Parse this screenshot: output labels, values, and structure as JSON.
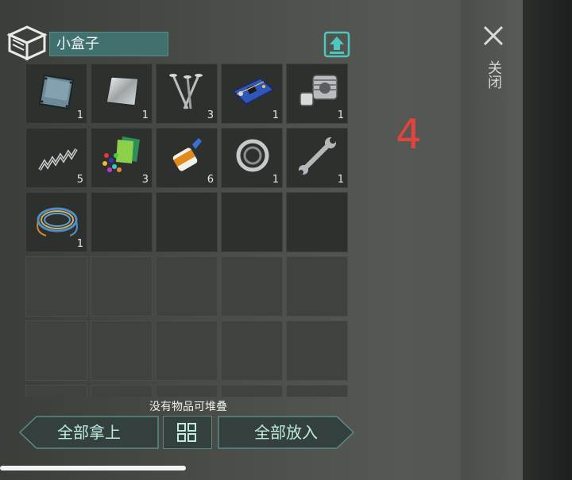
{
  "container": {
    "name": "小盒子",
    "overlay_number": "4"
  },
  "close": {
    "label": "关闭"
  },
  "inventory": {
    "slots": [
      {
        "item": "metal-plate",
        "qty": "1"
      },
      {
        "item": "steel-sheet",
        "qty": "1"
      },
      {
        "item": "nails",
        "qty": "3"
      },
      {
        "item": "circuit-board",
        "qty": "1"
      },
      {
        "item": "engine-cylinder",
        "qty": "1"
      },
      {
        "item": "spring",
        "qty": "5"
      },
      {
        "item": "fabric-and-beads",
        "qty": "3"
      },
      {
        "item": "glue-bottle",
        "qty": "6"
      },
      {
        "item": "bearing",
        "qty": "1"
      },
      {
        "item": "wrench",
        "qty": "1"
      },
      {
        "item": "wire-coil",
        "qty": "1"
      }
    ]
  },
  "footer": {
    "stack_status": "没有物品可堆叠",
    "take_all_label": "全部拿上",
    "put_all_label": "全部放入"
  },
  "colors": {
    "accent": "#41716e",
    "number": "#e2433f",
    "button_text": "#bfe9e3"
  }
}
